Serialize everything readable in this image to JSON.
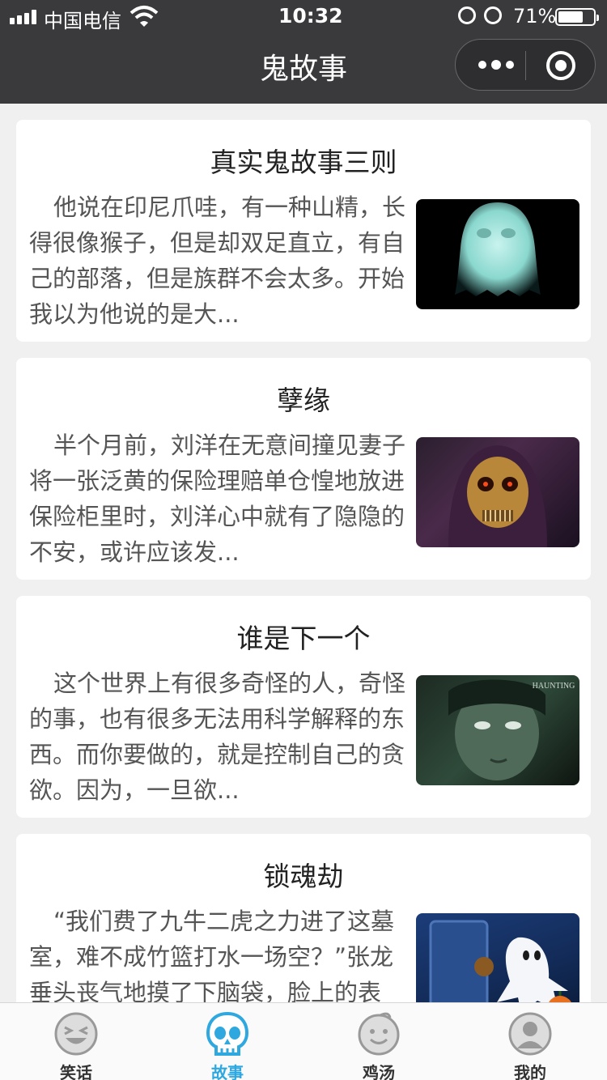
{
  "status_bar": {
    "carrier": "中国电信",
    "time": "10:32",
    "battery_percent": "71%",
    "battery_level": 0.71
  },
  "nav": {
    "title": "鬼故事",
    "more_icon": "more-dots-icon",
    "close_icon": "target-circle-icon"
  },
  "stories": [
    {
      "title": "真实鬼故事三则",
      "excerpt": "他说在印尼爪哇，有一种山精，长得很像猴子，但是却双足直立，有自己的部落，但是族群不会太多。开始我以为他说的是大...",
      "thumb_icon": "ghost-thumbnail"
    },
    {
      "title": "孽缘",
      "excerpt": "半个月前，刘洋在无意间撞见妻子将一张泛黄的保险理赔单仓惶地放进保险柜里时，刘洋心中就有了隐隐的不安，或许应该发...",
      "thumb_icon": "skull-thumbnail"
    },
    {
      "title": "谁是下一个",
      "excerpt": "这个世界上有很多奇怪的人，奇怪的事，也有很多无法用科学解释的东西。而你要做的，就是控制自己的贪欲。因为，一旦欲...",
      "thumb_icon": "face-thumbnail",
      "thumb_caption": "HAUNTING"
    },
    {
      "title": "锁魂劫",
      "excerpt": "“我们费了九牛二虎之力进了这墓室，难不成竹篮打水一场空？”张龙垂头丧气地摸了下脑袋，脸上的表",
      "thumb_icon": "halloween-ghost-thumbnail"
    }
  ],
  "tabs": [
    {
      "label": "笑话",
      "icon": "laugh-face-icon"
    },
    {
      "label": "故事",
      "icon": "skull-icon",
      "active": true
    },
    {
      "label": "鸡汤",
      "icon": "smile-face-icon"
    },
    {
      "label": "我的",
      "icon": "user-icon"
    }
  ],
  "colors": {
    "nav_bg": "#3a3a3c",
    "page_bg": "#f0f0f0",
    "active_tab": "#2fa8e0"
  }
}
